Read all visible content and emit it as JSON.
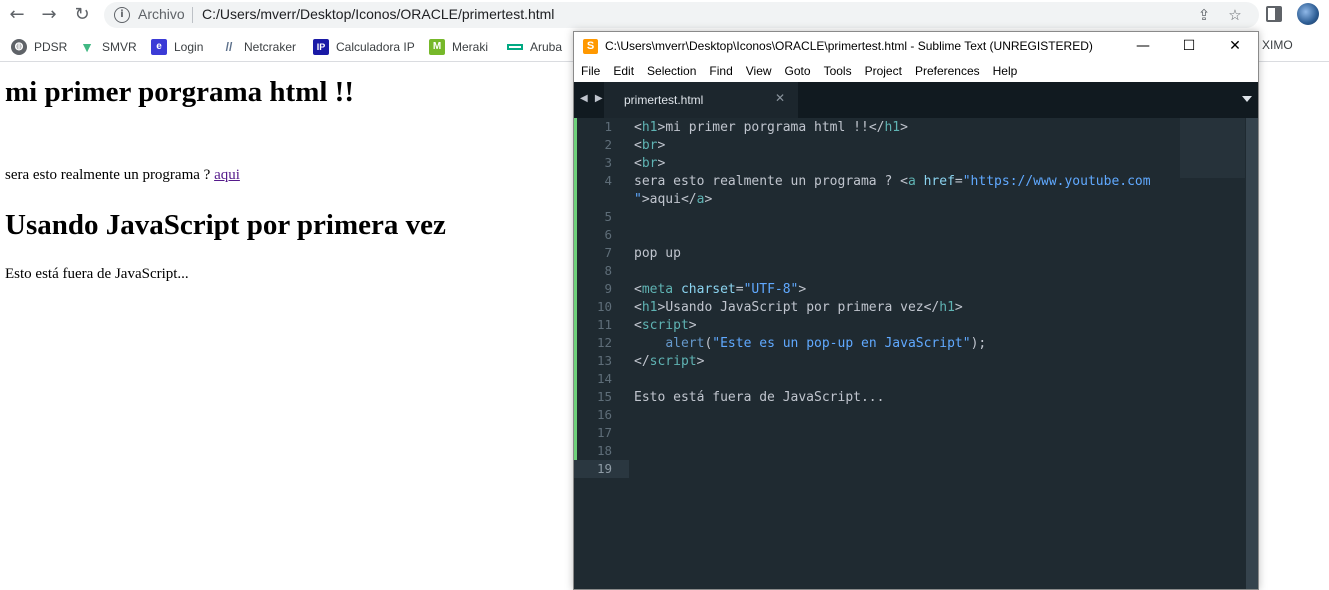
{
  "browser": {
    "omnibox": {
      "scheme_label": "Archivo",
      "url": "C:/Users/mverr/Desktop/Iconos/ORACLE/primertest.html"
    },
    "bookmarks": [
      {
        "label": "PDSR",
        "icon": "globe-icon",
        "color": "#5f6368"
      },
      {
        "label": "SMVR",
        "icon": "vue-icon",
        "color": "#41b883"
      },
      {
        "label": "Login",
        "icon": "e-icon",
        "color": "#3b3bd6"
      },
      {
        "label": "Netcraker",
        "icon": "netcracker-icon",
        "color": "#5b6f8a"
      },
      {
        "label": "Calculadora IP",
        "icon": "ip-icon",
        "color": "#1a1aa6"
      },
      {
        "label": "Meraki",
        "icon": "meraki-icon",
        "color": "#76b82a"
      },
      {
        "label": "Aruba",
        "icon": "aruba-icon",
        "color": "#01a982"
      }
    ],
    "bookmarks_overflow": "XIMO"
  },
  "page": {
    "heading1": "mi primer porgrama html !!",
    "paragraph1": "sera esto realmente un programa ?",
    "link_text": "aqui",
    "heading2": "Usando JavaScript por primera vez",
    "paragraph2": "Esto está fuera de JavaScript..."
  },
  "sublime": {
    "title": "C:\\Users\\mverr\\Desktop\\Iconos\\ORACLE\\primertest.html - Sublime Text (UNREGISTERED)",
    "menu": [
      "File",
      "Edit",
      "Selection",
      "Find",
      "View",
      "Goto",
      "Tools",
      "Project",
      "Preferences",
      "Help"
    ],
    "tab_label": "primertest.html",
    "line_numbers": [
      "1",
      "2",
      "3",
      "4",
      "",
      "5",
      "6",
      "7",
      "8",
      "9",
      "10",
      "11",
      "12",
      "13",
      "14",
      "15",
      "16",
      "17",
      "18",
      "19"
    ],
    "code": {
      "l1": {
        "open": "<",
        "tag": "h1",
        "close": ">",
        "text": "mi primer porgrama html !!",
        "end_open": "</",
        "end_tag": "h1",
        "end_close": ">"
      },
      "l2": {
        "open": "<",
        "tag": "br",
        "close": ">"
      },
      "l3": {
        "open": "<",
        "tag": "br",
        "close": ">"
      },
      "l4": {
        "text": "sera esto realmente un programa ? ",
        "open": "<",
        "tag": "a",
        "attr": "href",
        "eq": "=",
        "value": "\"https://www.youtube.com"
      },
      "l4b": {
        "value": "\"",
        "close": ">",
        "text": "aqui",
        "end_open": "</",
        "end_tag": "a",
        "end_close": ">"
      },
      "l7": {
        "text": "pop up"
      },
      "l9": {
        "open": "<",
        "tag": "meta",
        "attr": "charset",
        "eq": "=",
        "value": "\"UTF-8\"",
        "close": ">"
      },
      "l10": {
        "open": "<",
        "tag": "h1",
        "close": ">",
        "text": "Usando JavaScript por primera vez",
        "end_open": "</",
        "end_tag": "h1",
        "end_close": ">"
      },
      "l11": {
        "open": "<",
        "tag": "script",
        "close": ">"
      },
      "l12": {
        "indent": "    ",
        "fn": "alert",
        "paren_open": "(",
        "value": "\"Este es un pop-up en JavaScript\"",
        "paren_close": ");"
      },
      "l13": {
        "open": "</",
        "tag": "script",
        "close": ">"
      },
      "l15": {
        "text": "Esto está fuera de JavaScript..."
      }
    }
  }
}
